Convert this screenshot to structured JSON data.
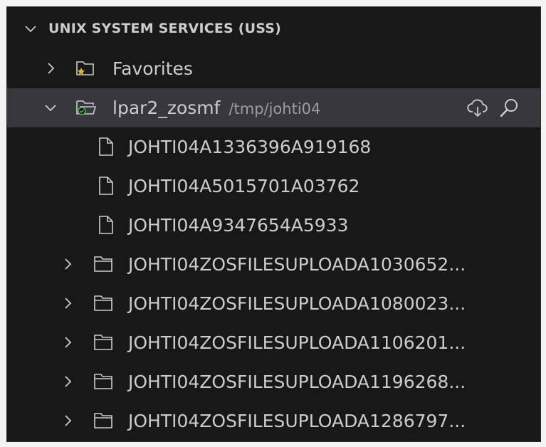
{
  "section": {
    "title": "UNIX SYSTEM SERVICES (USS)"
  },
  "favorites": {
    "label": "Favorites"
  },
  "profile": {
    "name": "lpar2_zosmf",
    "path": "/tmp/johti04"
  },
  "files": [
    {
      "name": "JOHTI04A1336396A919168"
    },
    {
      "name": "JOHTI04A5015701A03762"
    },
    {
      "name": "JOHTI04A9347654A5933"
    }
  ],
  "folders": [
    {
      "name": "JOHTI04ZOSFILESUPLOADA1030652..."
    },
    {
      "name": "JOHTI04ZOSFILESUPLOADA1080023..."
    },
    {
      "name": "JOHTI04ZOSFILESUPLOADA1106201..."
    },
    {
      "name": "JOHTI04ZOSFILESUPLOADA1196268..."
    },
    {
      "name": "JOHTI04ZOSFILESUPLOADA1286797..."
    }
  ],
  "colors": {
    "background": "#181818",
    "selected_row": "#37373d",
    "text": "#cccccc",
    "description": "#9d9d9d",
    "favorite_star": "#e8b23a",
    "profile_badge": "#4caf50"
  }
}
